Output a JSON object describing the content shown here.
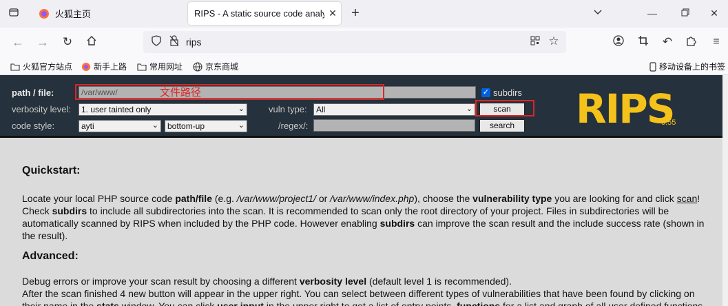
{
  "browser": {
    "tabs": [
      {
        "title": "火狐主页",
        "active": false
      },
      {
        "title": "RIPS - A static source code analyser for vulnerabilities in PHP scripts",
        "active": true
      }
    ],
    "url": "rips",
    "bookmarks": [
      "火狐官方站点",
      "新手上路",
      "常用网址",
      "京东商城"
    ],
    "mobile_bookmarks": "移动设备上的书签"
  },
  "rips": {
    "path_label": "path / file:",
    "path_value": "/var/www/",
    "path_annotation": "文件路径",
    "subdirs_label": "subdirs",
    "subdirs_checked": true,
    "verbosity_label": "verbosity level:",
    "verbosity_value": "1. user tainted only",
    "vuln_label": "vuln type:",
    "vuln_value": "All",
    "scan_button": "scan",
    "code_style_label": "code style:",
    "code_style_value": "ayti",
    "order_value": "bottom-up",
    "regex_label": "/regex/:",
    "regex_value": "",
    "search_button": "search",
    "logo": "RIPS",
    "version": "0.55",
    "accent_color": "#f4c21b"
  },
  "content": {
    "quickstart_title": "Quickstart:",
    "quickstart_text": [
      {
        "t": "Locate your local PHP source code ",
        "s": "n"
      },
      {
        "t": "path/file",
        "s": "b"
      },
      {
        "t": " (e.g. ",
        "s": "n"
      },
      {
        "t": "/var/www/project1/",
        "s": "i"
      },
      {
        "t": " or ",
        "s": "n"
      },
      {
        "t": "/var/www/index.php",
        "s": "i"
      },
      {
        "t": "), choose the ",
        "s": "n"
      },
      {
        "t": "vulnerability type",
        "s": "b"
      },
      {
        "t": " you are looking for and click ",
        "s": "n"
      },
      {
        "t": "scan",
        "s": "u"
      },
      {
        "t": "! Check ",
        "s": "n"
      },
      {
        "t": "subdirs",
        "s": "b"
      },
      {
        "t": " to include all subdirectories into the scan. It is recommended to scan only the root directory of your project. Files in subdirectories will be automatically scanned by RIPS when included by the PHP code. However enabling ",
        "s": "n"
      },
      {
        "t": "subdirs",
        "s": "b"
      },
      {
        "t": " can improve the scan result and the include success rate (shown in the result).",
        "s": "n"
      }
    ],
    "advanced_title": "Advanced:",
    "advanced_text": [
      {
        "t": "Debug errors or improve your scan result by choosing a different ",
        "s": "n"
      },
      {
        "t": "verbosity level",
        "s": "b"
      },
      {
        "t": " (default level 1 is recommended).",
        "s": "n"
      },
      {
        "t": "",
        "s": "br"
      },
      {
        "t": "After the scan finished 4 new button will appear in the upper right. You can select between different types of vulnerabilities that have been found by clicking on their name in the ",
        "s": "n"
      },
      {
        "t": "stats",
        "s": "b"
      },
      {
        "t": " window. You can click ",
        "s": "n"
      },
      {
        "t": "user input",
        "s": "b"
      },
      {
        "t": " in the upper right to get a list of entry points, ",
        "s": "n"
      },
      {
        "t": "functions",
        "s": "b"
      },
      {
        "t": " for a list and graph of all user defined functions",
        "s": "n"
      }
    ]
  }
}
